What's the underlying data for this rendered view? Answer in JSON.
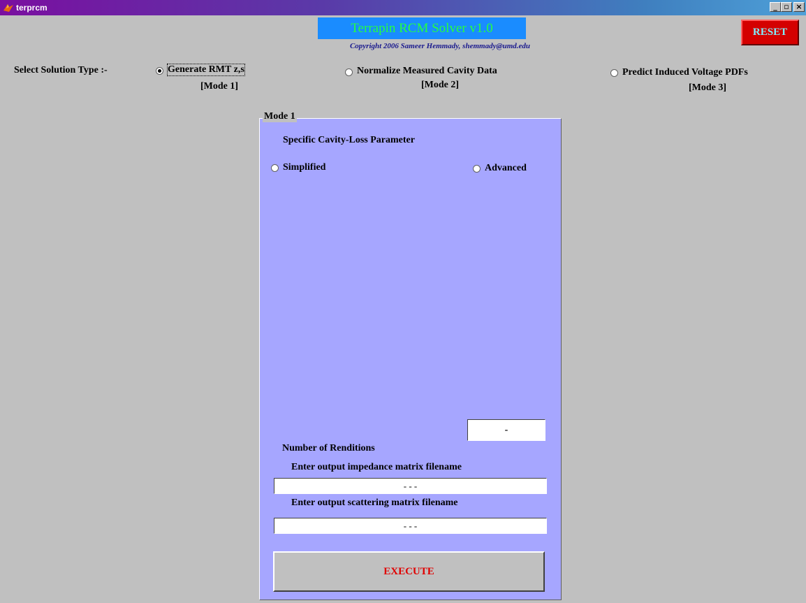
{
  "window": {
    "title": "terprcm",
    "controls": {
      "minimize": "_",
      "maximize": "▫",
      "close": "×"
    }
  },
  "header": {
    "banner": "Terrapin RCM Solver v1.0",
    "copyright": "Copyright 2006 Sameer Hemmady, shemmady@umd.edu",
    "reset_label": "RESET"
  },
  "solution_type": {
    "label": "Select Solution Type :-",
    "options": [
      {
        "label": "Generate RMT z,s",
        "mode": "[Mode 1]",
        "selected": true
      },
      {
        "label": "Normalize Measured Cavity Data",
        "mode": "[Mode 2]",
        "selected": false
      },
      {
        "label": "Predict Induced Voltage PDFs",
        "mode": "[Mode 3]",
        "selected": false
      }
    ]
  },
  "panel": {
    "title": "Mode 1",
    "loss_parameter_label": "Specific Cavity-Loss Parameter",
    "loss_options": [
      {
        "label": "Simplified",
        "selected": false
      },
      {
        "label": "Advanced",
        "selected": false
      }
    ],
    "renditions_label": "Number of Renditions",
    "renditions_value": "-",
    "impedance_label": "Enter output impedance matrix filename",
    "impedance_value": "- - -",
    "scattering_label": "Enter output scattering matrix filename",
    "scattering_value": "- - -",
    "execute_label": "EXECUTE"
  },
  "colors": {
    "banner_bg": "#1a8cff",
    "banner_text": "#25ff40",
    "reset_bg": "#d40000",
    "panel_bg": "#a6a6ff",
    "execute_text": "#e00000"
  }
}
